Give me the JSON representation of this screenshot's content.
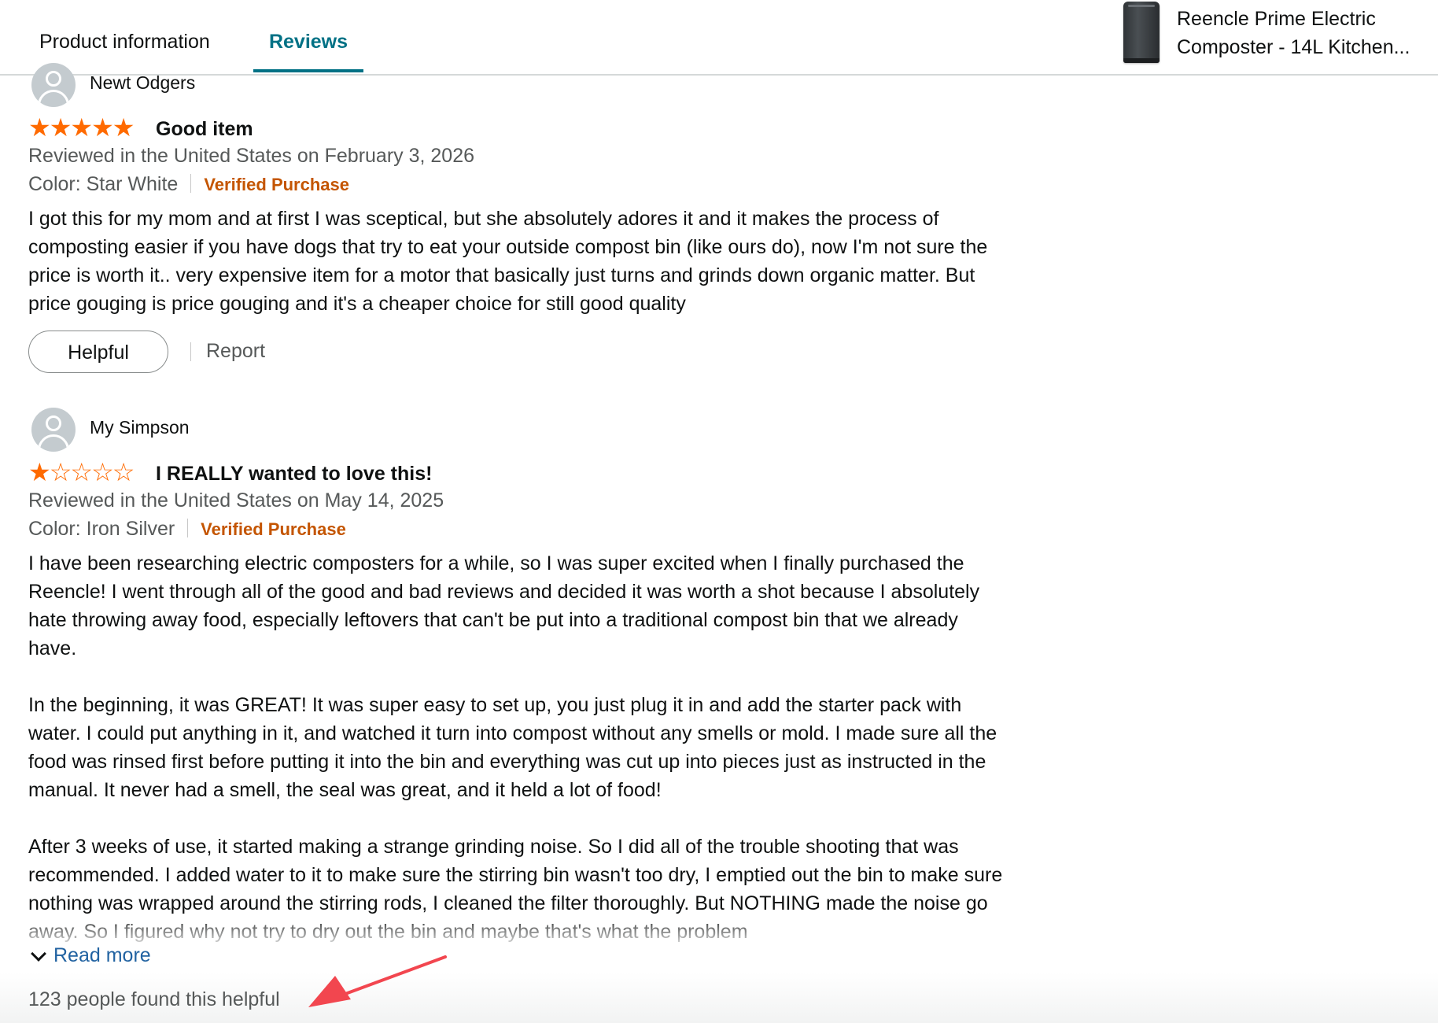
{
  "tabs": {
    "product_info": "Product information",
    "reviews": "Reviews",
    "active": "Reviews"
  },
  "product": {
    "title": "Reencle Prime Electric Composter - 14L Kitchen..."
  },
  "reviews": [
    {
      "reviewer": "Newt Odgers",
      "rating": 5,
      "stars_text": "★★★★★",
      "title": "Good item",
      "date": "Reviewed in the United States on February 3, 2026",
      "color": "Color: Star White",
      "verified": "Verified Purchase",
      "body": [
        "I got this for my mom and at first I was sceptical, but she absolutely adores it and it makes the process of composting easier if you have dogs that try to eat your outside compost bin (like ours do), now I'm not sure the price is worth it.. very expensive item for a motor that basically just turns and grinds down organic matter. But price gouging is price gouging and it's a cheaper choice for still good quality"
      ],
      "helpful_label": "Helpful",
      "report_label": "Report"
    },
    {
      "reviewer": "My Simpson",
      "rating": 1,
      "stars_text": "★☆☆☆☆",
      "title": "I REALLY wanted to love this!",
      "date": "Reviewed in the United States on May 14, 2025",
      "color": "Color: Iron Silver",
      "verified": "Verified Purchase",
      "body": [
        "I have been researching electric composters for a while, so I was super excited when I finally purchased the Reencle! I went through all of the good and bad reviews and decided it was worth a shot because I absolutely hate throwing away food, especially leftovers that can't be put into a traditional compost bin that we already have.",
        "In the beginning, it was GREAT! It was super easy to set up, you just plug it in and add the starter pack with water. I could put anything in it, and watched it turn into compost without any smells or mold. I made sure all the food was rinsed first before putting it into the bin and everything was cut up into pieces just as instructed in the manual. It never had a smell, the seal was great, and it held a lot of food!",
        "After 3 weeks of use, it started making a strange grinding noise. So I did all of the trouble shooting that was recommended. I added water to it to make sure the stirring bin wasn't too dry, I emptied out the bin to make sure nothing was wrapped around the stirring rods, I cleaned the filter thoroughly. But NOTHING made the noise go away. So I figured why not try to dry out the bin and maybe that's what the problem"
      ],
      "read_more": "Read more",
      "helpful_count": "123 people found this helpful"
    }
  ],
  "colors": {
    "accent_tab": "#007185",
    "star": "#ff6a00",
    "verified": "#c45500",
    "link": "#2162a1",
    "annotation_arrow": "#f2464f"
  }
}
